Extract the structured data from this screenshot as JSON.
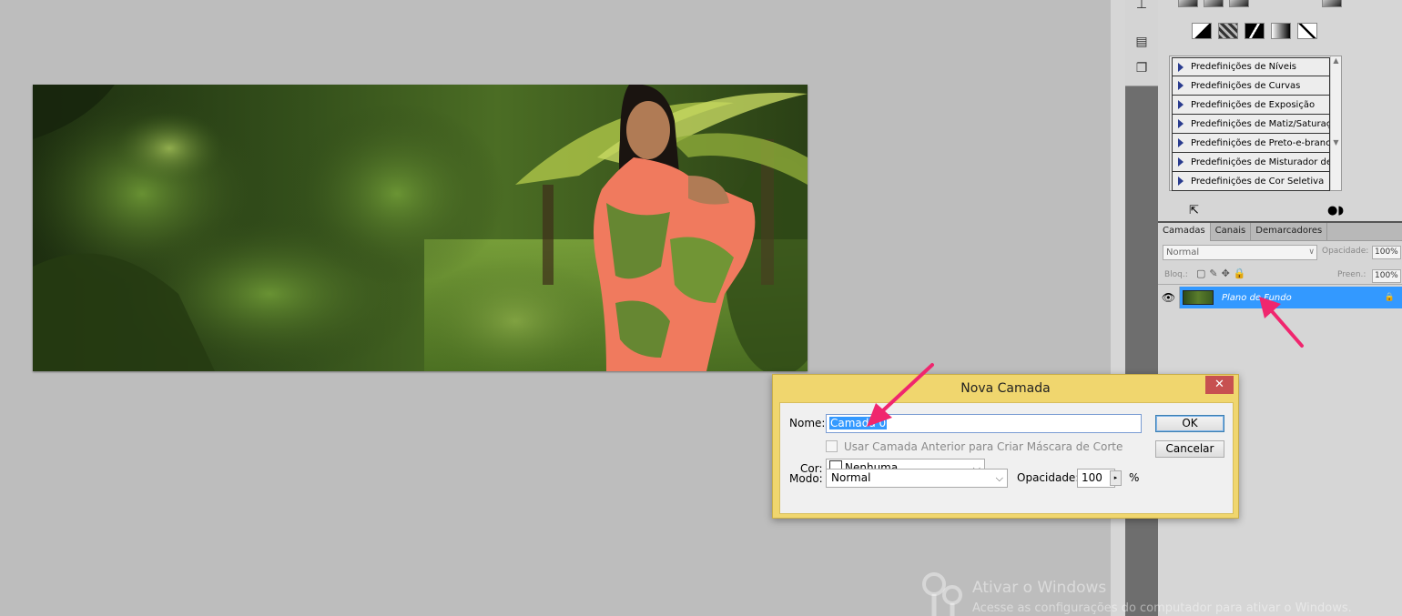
{
  "dialog": {
    "title": "Nova Camada",
    "close_icon": "close-icon",
    "name_label": "Nome:",
    "name_value": "Camada 0",
    "clip_label": "Usar Camada Anterior para Criar Máscara de Corte",
    "color_label": "Cor:",
    "color_value": "Nenhuma",
    "mode_label": "Modo:",
    "mode_value": "Normal",
    "opacity_label": "Opacidade:",
    "opacity_value": "100",
    "opacity_unit": "%",
    "ok_label": "OK",
    "cancel_label": "Cancelar"
  },
  "adjustments": {
    "items": [
      "Predefinições de Níveis",
      "Predefinições de Curvas",
      "Predefinições de Exposição",
      "Predefinições de Matiz/Saturação",
      "Predefinições de Preto-e-branco",
      "Predefinições de Misturador de ...",
      "Predefinições de Cor Seletiva"
    ]
  },
  "layers_panel": {
    "tabs": [
      "Camadas",
      "Canais",
      "Demarcadores"
    ],
    "blend_mode": "Normal",
    "opacity_label": "Opacidade:",
    "opacity_value": "100%",
    "lock_label": "Bloq.:",
    "fill_label": "Preen.:",
    "fill_value": "100%",
    "layer_name": "Plano de Fundo"
  },
  "watermark": {
    "title": "Ativar o Windows",
    "subtitle": "Acesse as configurações do computador para ativar o Windows."
  },
  "colors": {
    "dialog_frame": "#f0d66e",
    "selection_blue": "#3399ff",
    "arrow_pink": "#f0266e"
  }
}
